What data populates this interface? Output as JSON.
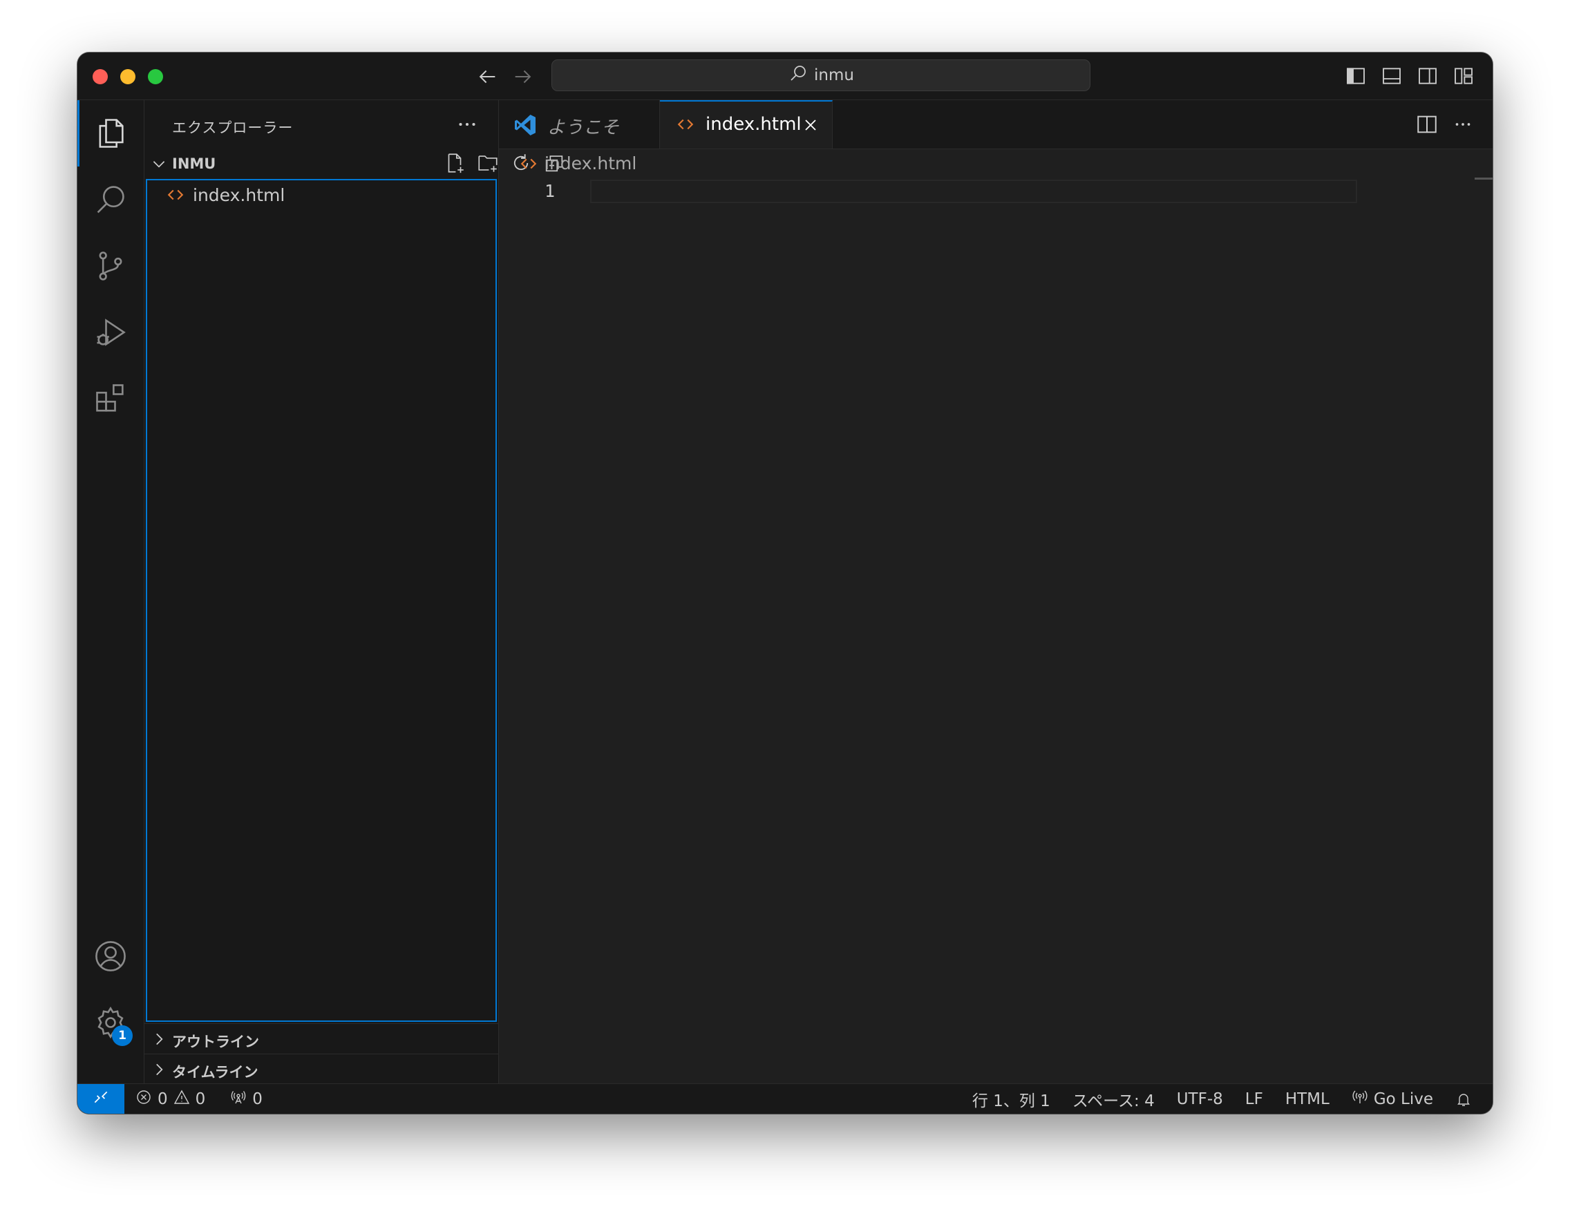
{
  "titlebar": {
    "search_text": "inmu"
  },
  "activitybar": {
    "items": [
      "explorer-icon",
      "search-icon",
      "source-control-icon",
      "run-debug-icon",
      "extensions-icon"
    ],
    "bottom_items": [
      "accounts-icon",
      "manage-gear-icon"
    ],
    "settings_badge": "1"
  },
  "sidebar": {
    "title": "エクスプローラー",
    "folder": "INMU",
    "files": [
      {
        "name": "index.html",
        "icon": "html-file-icon"
      }
    ],
    "sections": [
      {
        "label": "アウトライン"
      },
      {
        "label": "タイムライン"
      }
    ]
  },
  "editor": {
    "tabs": [
      {
        "label": "ようこそ",
        "icon": "vscode-logo-icon",
        "active": false
      },
      {
        "label": "index.html",
        "icon": "html-file-icon",
        "active": true
      }
    ],
    "breadcrumb": "index.html",
    "line_numbers": [
      "1"
    ]
  },
  "statusbar": {
    "errors": "0",
    "warnings": "0",
    "ports": "0",
    "cursor": "行 1、列 1",
    "indent": "スペース: 4",
    "encoding": "UTF-8",
    "eol": "LF",
    "language": "HTML",
    "golive": "Go Live"
  },
  "colors": {
    "accent": "#0078d4",
    "html_icon": "#e37933",
    "background": "#1f1f1f",
    "sidebar": "#181818"
  }
}
